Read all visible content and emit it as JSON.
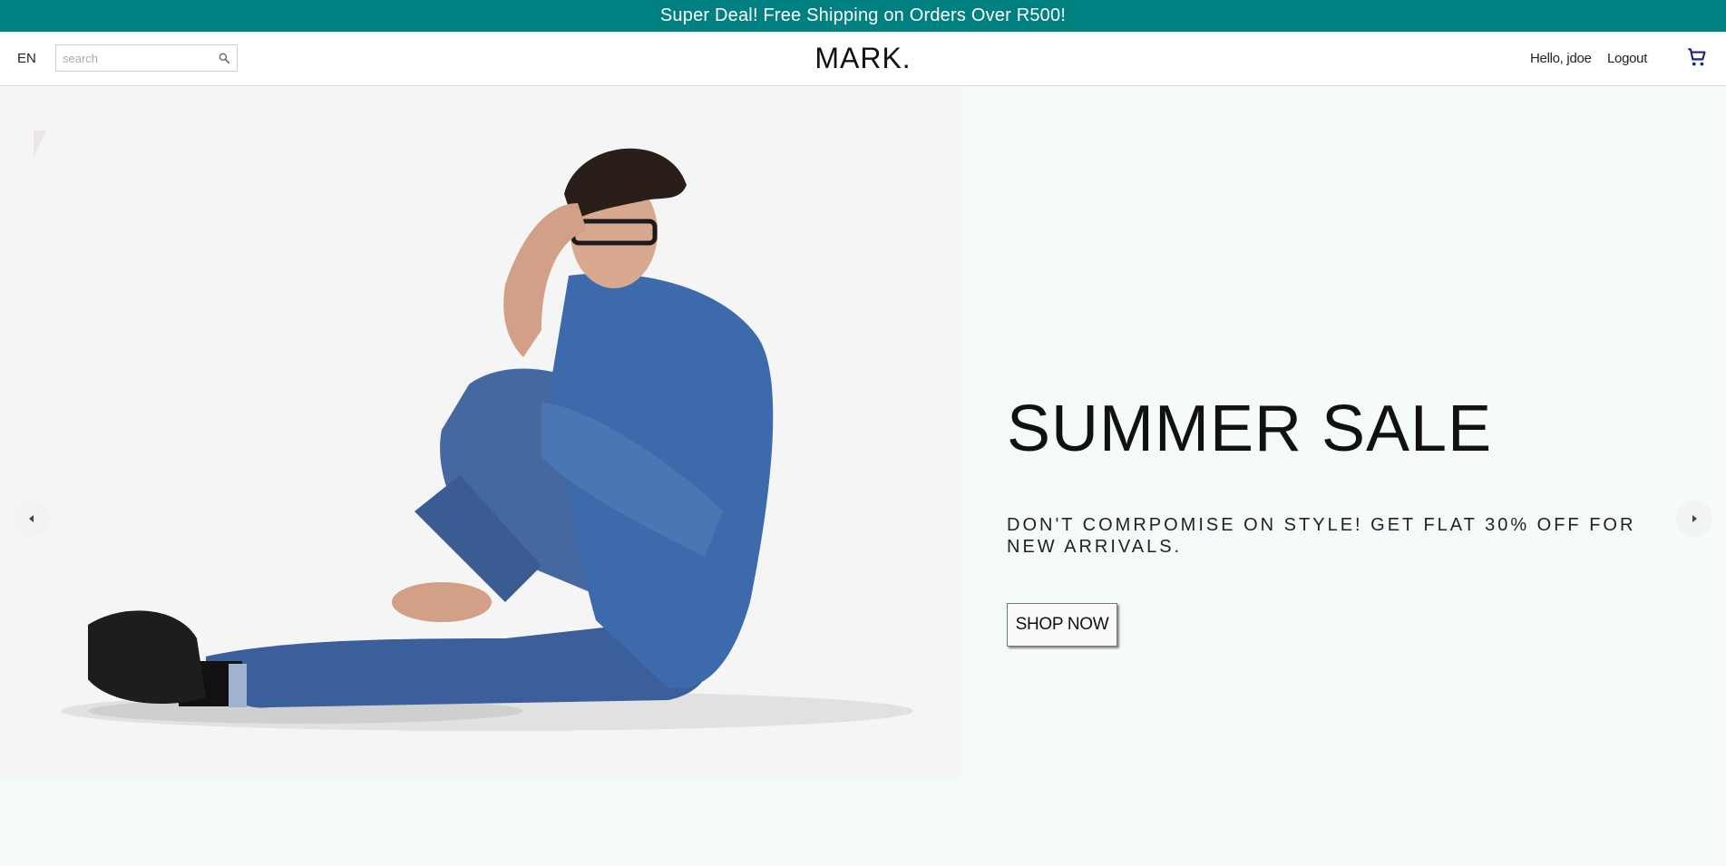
{
  "announcement": {
    "text": "Super Deal! Free Shipping on Orders Over R500!",
    "background": "#008080"
  },
  "navbar": {
    "language": "EN",
    "search": {
      "placeholder": "search",
      "value": "",
      "icon": "search-icon"
    },
    "logo": "MARK.",
    "greeting": "Hello, jdoe",
    "logout": "Logout",
    "cart_icon": "shopping-cart-icon",
    "cart_color": "#1a237e"
  },
  "hero": {
    "image": "man-in-denim-sitting-photo",
    "title": "SUMMER SALE",
    "subtitle": "Don't comrpomise on style! Get flat 30% off for new arrivals.",
    "button": "SHOP NOW",
    "prev_icon": "arrow-left-icon",
    "next_icon": "arrow-right-icon"
  }
}
